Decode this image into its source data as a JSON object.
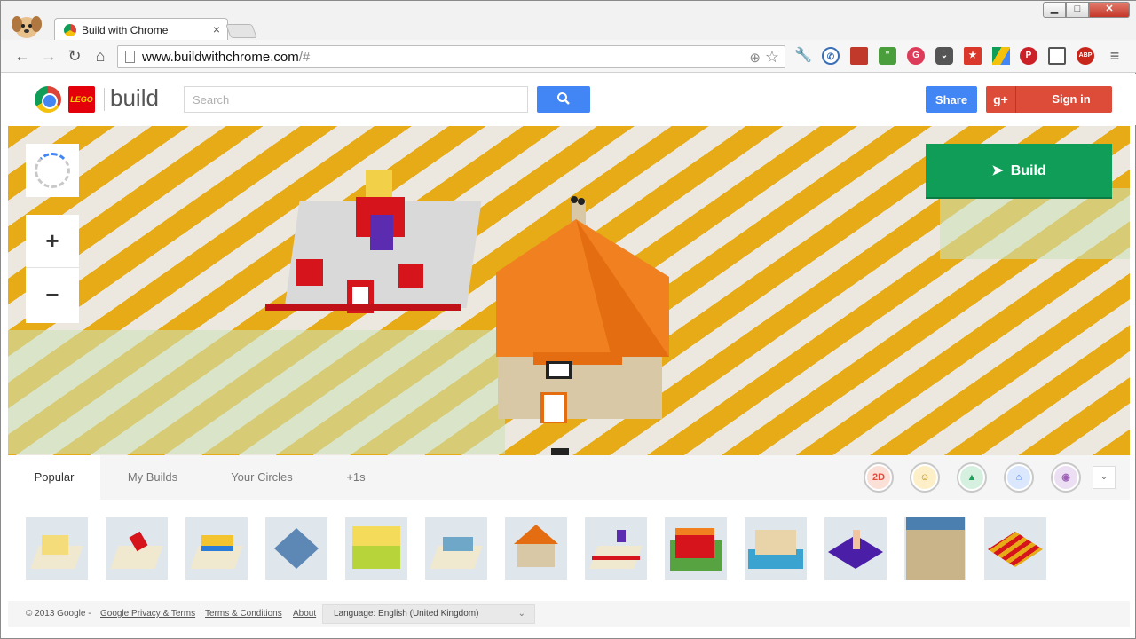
{
  "browser": {
    "tab_title": "Build with Chrome",
    "tab_close": "×",
    "url_host": "www.buildwithchrome.com",
    "url_path": "/#",
    "window_buttons": {
      "minimize": "▁",
      "maximize": "□",
      "close": "✕"
    },
    "nav": {
      "back": "←",
      "forward": "→",
      "reload": "↻",
      "home": "⌂"
    },
    "extensions": [
      "wrench-icon",
      "phone-icon",
      "bookmark-icon",
      "quote-icon",
      "g-icon",
      "pocket-icon",
      "star-icon",
      "drive-icon",
      "pinterest-icon",
      "cast-icon",
      "adblock-icon",
      "menu-icon"
    ],
    "extension_labels": {
      "g": "G",
      "abp": "ABP",
      "menu": "≡"
    }
  },
  "site": {
    "lego_label": "LEGO",
    "brand": "build",
    "search_placeholder": "Search",
    "share_label": "Share",
    "gplus_label": "g+",
    "signin_label": "Sign in"
  },
  "map": {
    "zoom_in": "+",
    "zoom_out": "−",
    "build_label": "Build",
    "colors": {
      "stripe": "#e6ab16",
      "ground": "#ece8e0",
      "build_button": "#0f9d58"
    }
  },
  "panel": {
    "tabs": [
      "Popular",
      "My Builds",
      "Your Circles",
      "+1s"
    ],
    "categories": [
      {
        "label": "2D",
        "icon": "2d-icon",
        "color": "#e34c3c"
      },
      {
        "label": "☺",
        "icon": "glasses-face-icon",
        "color": "#f5b400"
      },
      {
        "label": "▲",
        "icon": "rocket-icon",
        "color": "#1e9f5a"
      },
      {
        "label": "⌂",
        "icon": "building-icon",
        "color": "#4285f4"
      },
      {
        "label": "◉",
        "icon": "car-icon",
        "color": "#9c5fb5"
      }
    ],
    "dropdown": "⌄",
    "thumbnail_count": 13
  },
  "footer": {
    "copyright": "© 2013 Google  -",
    "privacy": "Google Privacy & Terms",
    "terms": "Terms & Conditions",
    "about": "About",
    "language": "Language: English (United Kingdom)"
  }
}
